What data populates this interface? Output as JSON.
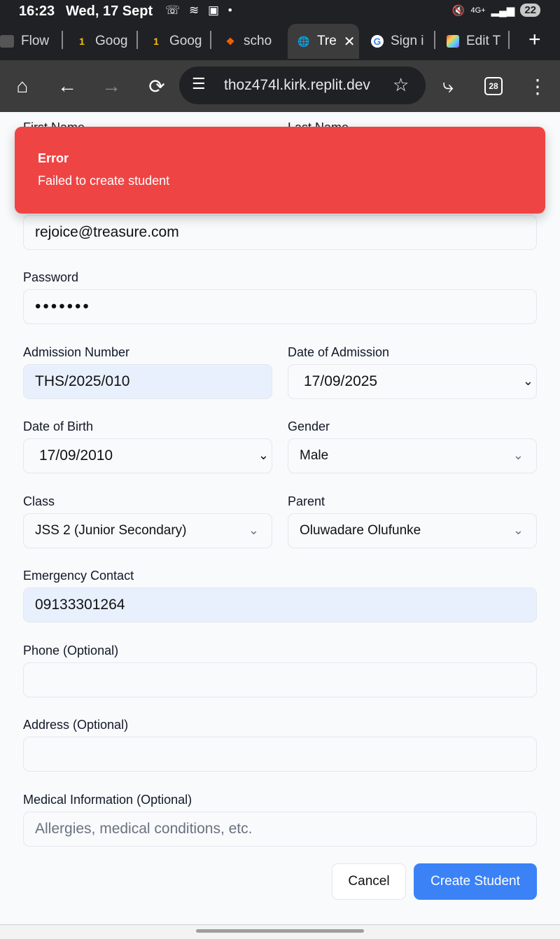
{
  "status_bar": {
    "time": "16:23",
    "date": "Wed, 17 Sept",
    "indicators": "4G+",
    "battery": "22"
  },
  "tabs": [
    {
      "label": "Flow",
      "icon": "flow-icon",
      "active": false
    },
    {
      "label": "Goog",
      "icon": "google-one-icon",
      "active": false
    },
    {
      "label": "Goog",
      "icon": "google-one-icon",
      "active": false
    },
    {
      "label": "scho",
      "icon": "replit-icon",
      "active": false
    },
    {
      "label": "Tre",
      "icon": "globe-icon",
      "active": true
    },
    {
      "label": "Sign i",
      "icon": "google-g-icon",
      "active": false
    },
    {
      "label": "Edit T",
      "icon": "gallery-icon",
      "active": false
    }
  ],
  "toolbar": {
    "url": "thoz474l.kirk.replit.dev",
    "tab_count": "28"
  },
  "form": {
    "hidden_labels": {
      "first_name": "First Name",
      "last_name": "Last Name"
    },
    "email_value": "rejoice@treasure.com",
    "password_label": "Password",
    "password_value": "•••••••",
    "admission_number_label": "Admission Number",
    "admission_number_value": "THS/2025/010",
    "date_of_admission_label": "Date of Admission",
    "date_of_admission_value": "17/09/2025",
    "date_of_birth_label": "Date of Birth",
    "date_of_birth_value": "17/09/2010",
    "gender_label": "Gender",
    "gender_value": "Male",
    "class_label": "Class",
    "class_value": "JSS 2 (Junior Secondary)",
    "parent_label": "Parent",
    "parent_value": "Oluwadare Olufunke",
    "emergency_contact_label": "Emergency Contact",
    "emergency_contact_value": "09133301264",
    "phone_label": "Phone (Optional)",
    "phone_value": "",
    "address_label": "Address (Optional)",
    "address_value": "",
    "medical_label": "Medical Information (Optional)",
    "medical_placeholder": "Allergies, medical conditions, etc."
  },
  "toast": {
    "title": "Error",
    "message": "Failed to create student",
    "color": "#ef4444"
  },
  "actions": {
    "cancel_label": "Cancel",
    "create_label": "Create Student",
    "accent": "#3b82f6"
  }
}
